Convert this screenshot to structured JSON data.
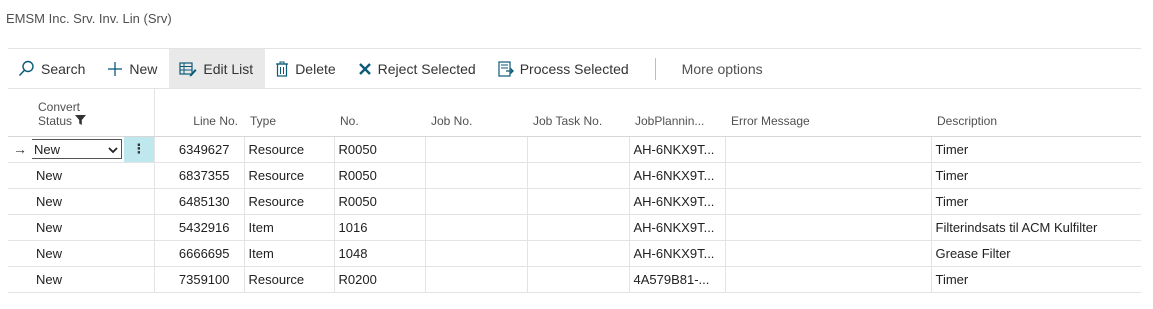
{
  "page": {
    "title": "EMSM Inc. Srv. Inv. Lin (Srv)"
  },
  "actions": {
    "search": "Search",
    "new": "New",
    "edit_list": "Edit List",
    "delete": "Delete",
    "reject_selected": "Reject Selected",
    "process_selected": "Process Selected",
    "more_options": "More options"
  },
  "columns": {
    "convert_status_line1": "Convert",
    "convert_status_line2": "Status",
    "line_no": "Line No.",
    "type": "Type",
    "no": "No.",
    "job_no": "Job No.",
    "job_task_no": "Job Task No.",
    "job_planning": "JobPlannin...",
    "error_message": "Error Message",
    "description": "Description"
  },
  "rows": [
    {
      "status": "New",
      "line_no": "6349627",
      "type": "Resource",
      "no": "R0050",
      "job_no": "",
      "job_task_no": "",
      "job_planning": "AH-6NKX9T...",
      "error": "",
      "description": "Timer"
    },
    {
      "status": "New",
      "line_no": "6837355",
      "type": "Resource",
      "no": "R0050",
      "job_no": "",
      "job_task_no": "",
      "job_planning": "AH-6NKX9T...",
      "error": "",
      "description": "Timer"
    },
    {
      "status": "New",
      "line_no": "6485130",
      "type": "Resource",
      "no": "R0050",
      "job_no": "",
      "job_task_no": "",
      "job_planning": "AH-6NKX9T...",
      "error": "",
      "description": "Timer"
    },
    {
      "status": "New",
      "line_no": "5432916",
      "type": "Item",
      "no": "1016",
      "job_no": "",
      "job_task_no": "",
      "job_planning": "AH-6NKX9T...",
      "error": "",
      "description": "Filterindsats til ACM Kulfilter"
    },
    {
      "status": "New",
      "line_no": "6666695",
      "type": "Item",
      "no": "1048",
      "job_no": "",
      "job_task_no": "",
      "job_planning": "AH-6NKX9T...",
      "error": "",
      "description": "Grease Filter"
    },
    {
      "status": "New",
      "line_no": "7359100",
      "type": "Resource",
      "no": "R0200",
      "job_no": "",
      "job_task_no": "",
      "job_planning": "4A579B81-...",
      "error": "",
      "description": "Timer"
    }
  ],
  "icons": {
    "search": "search-icon",
    "new": "plus-icon",
    "edit_list": "edit-list-icon",
    "delete": "trash-icon",
    "reject": "x-icon",
    "process": "process-icon",
    "filter": "filter-icon",
    "row_arrow": "arrow-right-icon",
    "dropdown": "chevron-down-icon",
    "row_menu": "more-vertical-icon"
  },
  "colors": {
    "accent": "#0a5a78",
    "selected_bg": "#e9e9e9",
    "row_menu_bg": "#bfe8ee"
  }
}
